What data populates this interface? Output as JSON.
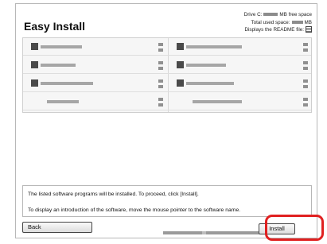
{
  "window": {
    "title": "Easy Install"
  },
  "info": {
    "drive_prefix": "Drive C:",
    "drive_suffix": "MB free space",
    "used_prefix": "Total used space:",
    "used_suffix": "MB",
    "readme_label": "Displays the README file:",
    "readme_icon": "document-icon"
  },
  "software_list": {
    "rows": [
      {
        "left_name_width": 52,
        "right_name_width": 70
      },
      {
        "left_name_width": 44,
        "right_name_width": 50
      },
      {
        "left_name_width": 66,
        "right_name_width": 60
      },
      {
        "left_name_width": 40,
        "right_name_width": 62,
        "left_icon": false,
        "right_icon": false
      }
    ]
  },
  "description": {
    "line1": "The listed software programs will be installed. To proceed, click [Install].",
    "line2": "To display an introduction of the software, move the mouse pointer to the software name."
  },
  "buttons": {
    "back": "Back",
    "install": "Install"
  },
  "highlight_color": "#e02020"
}
